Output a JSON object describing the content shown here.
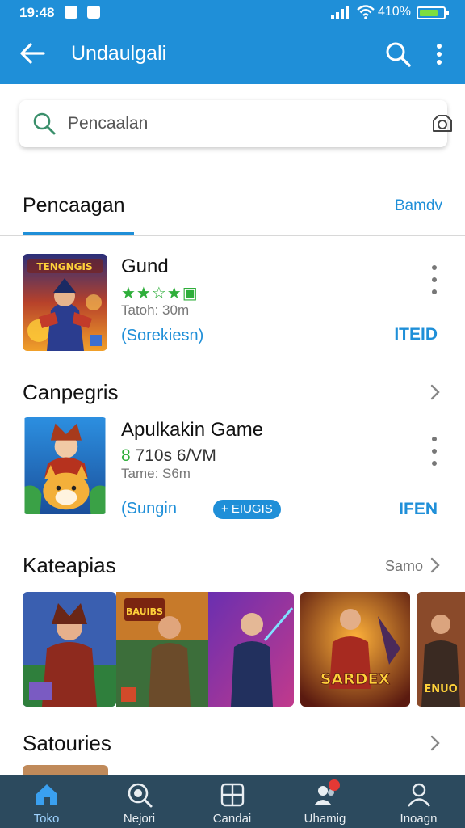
{
  "status_bar": {
    "time": "19:48",
    "battery": "410%"
  },
  "app_bar": {
    "title": "Undaulgali",
    "back_icon": "arrow-left-icon",
    "search_icon": "search-icon",
    "more_icon": "more-vert-icon"
  },
  "search": {
    "placeholder": "Pencaalan"
  },
  "tabs": {
    "active": "Pencaagan",
    "link": "Bamdv"
  },
  "apps": [
    {
      "thumb_text": "TENGNGIS",
      "name": "Gund",
      "rating": "★★☆★▣",
      "size": "Tatoh: 30m",
      "subtitle": "(Sorekiesn)",
      "action": "ITEID"
    },
    {
      "name": "Apulkakin Game",
      "rating_prefix": "8",
      "rating": "710s 6/VM",
      "size": "Tame: S6m",
      "subtitle": "(Sungin",
      "chip": "+ EIUGIS",
      "action": "IFEN"
    }
  ],
  "sections": {
    "campaign": {
      "title": "Canpegris"
    },
    "categories": {
      "title": "Kateapias",
      "link": "Samo"
    },
    "saturies": {
      "title": "Satouries"
    }
  },
  "category_cards": [
    {
      "caption": ""
    },
    {
      "caption": "BAUIBS"
    },
    {
      "caption": ""
    },
    {
      "caption": "SARDEX"
    },
    {
      "caption": "ENUO"
    }
  ],
  "bottom_nav": [
    {
      "label": "Toko",
      "icon": "home-icon",
      "active": true
    },
    {
      "label": "Nejori",
      "icon": "search-icon",
      "active": false
    },
    {
      "label": "Candai",
      "icon": "grid-icon",
      "active": false
    },
    {
      "label": "Uhamig",
      "icon": "people-icon",
      "active": false
    },
    {
      "label": "Inoagn",
      "icon": "person-icon",
      "active": false
    }
  ],
  "colors": {
    "primary": "#1f8fd8",
    "nav_bg": "#2c4a5e",
    "rating_green": "#2eae3a",
    "badge": "#e53935"
  }
}
